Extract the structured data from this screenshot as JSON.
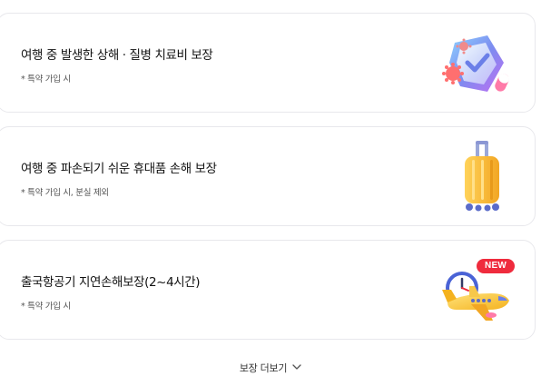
{
  "coverages": [
    {
      "title": "여행 중 발생한 상해 · 질병 치료비 보장",
      "note": "* 특약 가입 시",
      "icon": "medical-shield-icon"
    },
    {
      "title": "여행 중 파손되기 쉬운 휴대품 손해 보장",
      "note": "* 특약 가입 시, 분실 제외",
      "icon": "suitcase-icon"
    },
    {
      "title": "출국항공기 지연손해보장(2~4시간)",
      "note": "* 특약 가입 시",
      "icon": "airplane-clock-icon",
      "badge": "NEW"
    }
  ],
  "more_button": {
    "label": "보장 더보기",
    "icon": "chevron-down-icon"
  },
  "colors": {
    "badge": "#ef2b3d",
    "card_border": "#e8e8ec",
    "suitcase": "#f7b733",
    "plane": "#ffcf3d",
    "shield": "#7c8cf0"
  }
}
